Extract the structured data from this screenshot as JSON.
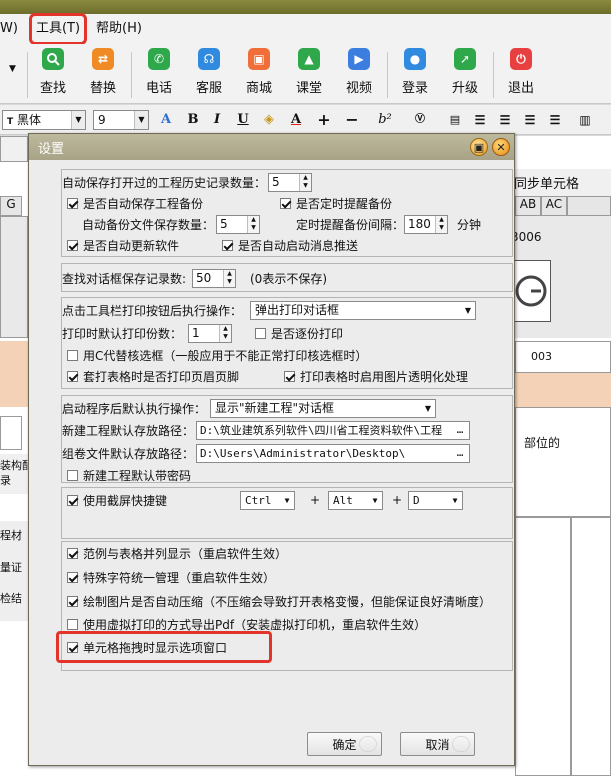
{
  "menubar": {
    "items": [
      "W)",
      "工具(T)",
      "帮助(H)"
    ]
  },
  "toolbar": {
    "buttons": [
      {
        "label": "查找",
        "icon": "search-icon",
        "color": "#2ea84a"
      },
      {
        "label": "替换",
        "icon": "replace-icon",
        "color": "#f08a24"
      },
      {
        "label": "电话",
        "icon": "phone-icon",
        "color": "#2ea84a"
      },
      {
        "label": "客服",
        "icon": "headset-icon",
        "color": "#2f8ae0"
      },
      {
        "label": "商城",
        "icon": "shop-icon",
        "color": "#f06e3a"
      },
      {
        "label": "课堂",
        "icon": "graduation-cap-icon",
        "color": "#2ea84a"
      },
      {
        "label": "视频",
        "icon": "play-icon",
        "color": "#3b7ee0"
      },
      {
        "label": "登录",
        "icon": "user-icon",
        "color": "#2f8ae0"
      },
      {
        "label": "升级",
        "icon": "rocket-icon",
        "color": "#2ea84a"
      },
      {
        "label": "退出",
        "icon": "power-icon",
        "color": "#e84040"
      }
    ]
  },
  "format": {
    "font_name": "黑体",
    "font_size": "9"
  },
  "background": {
    "sync_label": "同步单元格",
    "col_g": "G",
    "col_ab": "AB",
    "col_ac": "AC",
    "code_3006": "3006",
    "code_003": "003",
    "part_label": "部位的",
    "left_labels": [
      "装构配",
      "录",
      "程材",
      "量证",
      "检结"
    ]
  },
  "dialog": {
    "title": "设置",
    "history_count_label": "自动保存打开过的工程历史记录数量：",
    "history_count": "5",
    "auto_backup_label": "是否自动保存工程备份",
    "auto_backup_checked": true,
    "timed_remind_label": "是否定时提醒备份",
    "timed_remind_checked": true,
    "backup_count_label": "自动备份文件保存数量：",
    "backup_count": "5",
    "remind_interval_label": "定时提醒备份间隔：",
    "remind_interval": "180",
    "minutes_label": "分钟",
    "auto_update_label": "是否自动更新软件",
    "auto_update_checked": true,
    "auto_push_label": "是否自动启动消息推送",
    "auto_push_checked": true,
    "find_history_label": "查找对话框保存记录数:",
    "find_history_count": "50",
    "find_history_hint": "(0表示不保存)",
    "print_action_label": "点击工具栏打印按钮后执行操作：",
    "print_action_value": "弹出打印对话框",
    "print_copies_label": "打印时默认打印份数：",
    "print_copies": "1",
    "collate_label": "是否逐份打印",
    "collate_checked": false,
    "use_c_label": "用C代替核选框（一般应用于不能正常打印核选框时）",
    "use_c_checked": false,
    "header_footer_label": "套打表格时是否打印页眉页脚",
    "header_footer_checked": true,
    "transparent_label": "打印表格时启用图片透明化处理",
    "transparent_checked": true,
    "startup_action_label": "启动程序后默认执行操作：",
    "startup_action_value": "显示\"新建工程\"对话框",
    "new_project_path_label": "新建工程默认存放路径：",
    "new_project_path": "D:\\筑业建筑系列软件\\四川省工程资料软件\\工程",
    "volume_path_label": "组卷文件默认存放路径：",
    "volume_path": "D:\\Users\\Administrator\\Desktop\\",
    "new_with_pwd_label": "新建工程默认带密码",
    "new_with_pwd_checked": false,
    "screenshot_label": "使用截屏快捷键",
    "screenshot_checked": true,
    "key1": "Ctrl",
    "plus1": "+",
    "key2": "Alt",
    "plus2": "+",
    "key3": "D",
    "sample_label": "范例与表格并列显示（重启软件生效）",
    "sample_checked": true,
    "special_char_label": "特殊字符统一管理（重启软件生效）",
    "special_char_checked": true,
    "compress_label": "绘制图片是否自动压缩（不压缩会导致打开表格变慢，但能保证良好清晰度）",
    "compress_checked": true,
    "virtual_pdf_label": "使用虚拟打印的方式导出Pdf（安装虚拟打印机，重启软件生效）",
    "virtual_pdf_checked": false,
    "drag_popup_label": "单元格拖拽时显示选项窗口",
    "drag_popup_checked": true,
    "ok_label": "确定",
    "cancel_label": "取消"
  },
  "colors": {
    "highlight": "#e2342b",
    "titlebar": "#aaa589"
  }
}
